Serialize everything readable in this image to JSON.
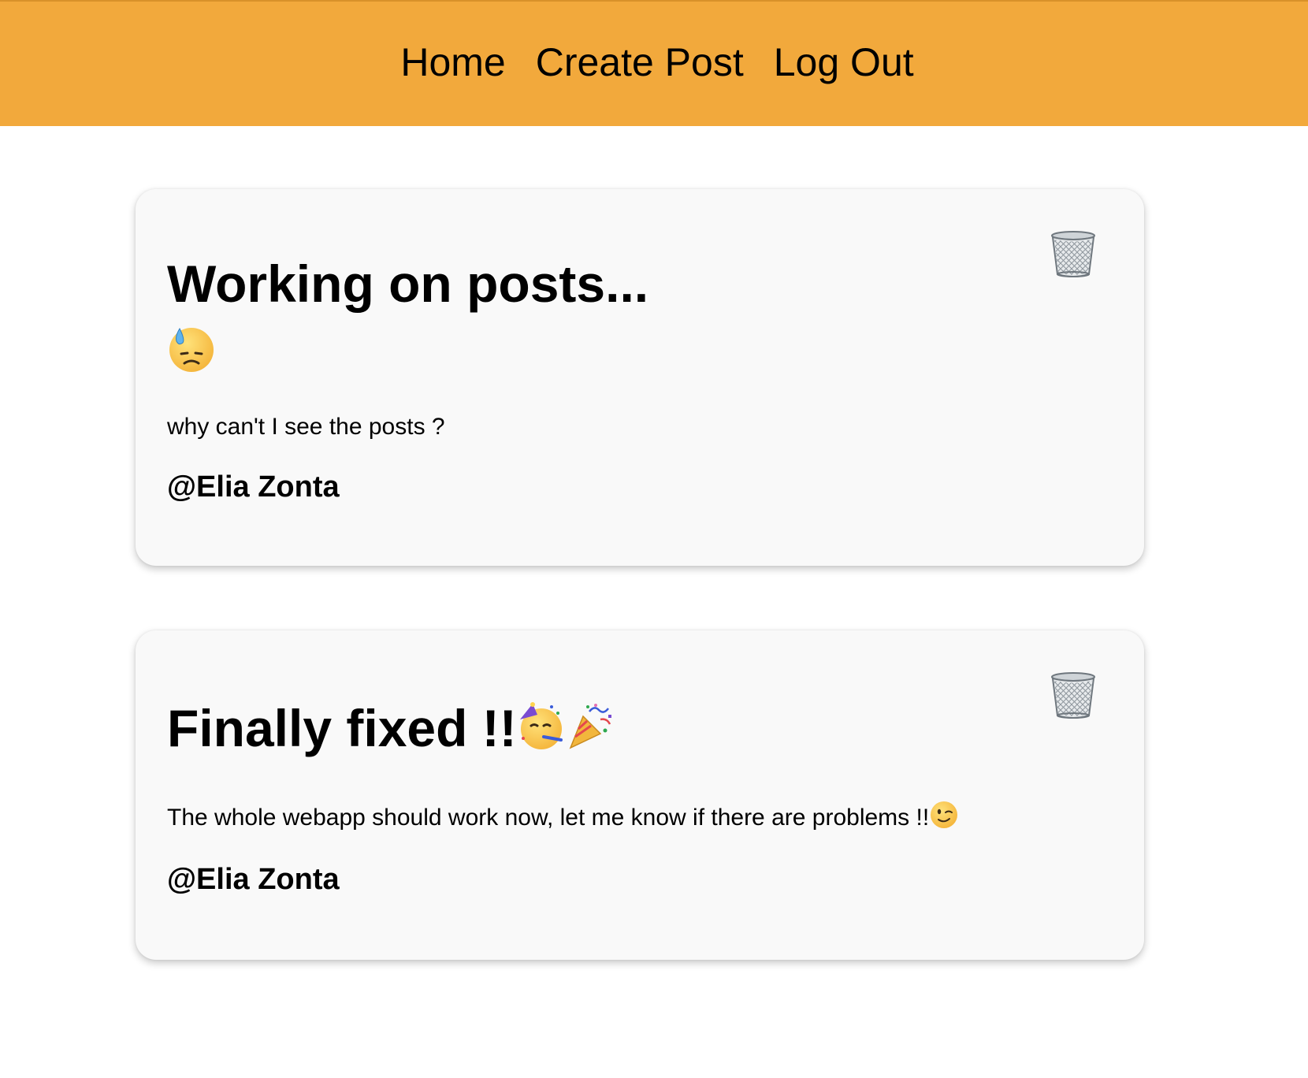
{
  "theme": {
    "navbar_color": "#f2a93c",
    "card_color": "#f9f9f9"
  },
  "nav": {
    "home": "Home",
    "create_post": "Create Post",
    "log_out": "Log Out"
  },
  "posts": [
    {
      "title": "Working on posts...",
      "title_emoji": "downcast-face-with-sweat",
      "body": "why can't I see the posts ?",
      "author": "@Elia Zonta",
      "delete_icon": "wastebasket-icon"
    },
    {
      "title": "Finally fixed !!",
      "title_emoji": "partying-face, party-popper",
      "body": "The whole webapp should work now, let me know if there are problems !!",
      "body_emoji": "winking-face",
      "author": "@Elia Zonta",
      "delete_icon": "wastebasket-icon"
    }
  ]
}
